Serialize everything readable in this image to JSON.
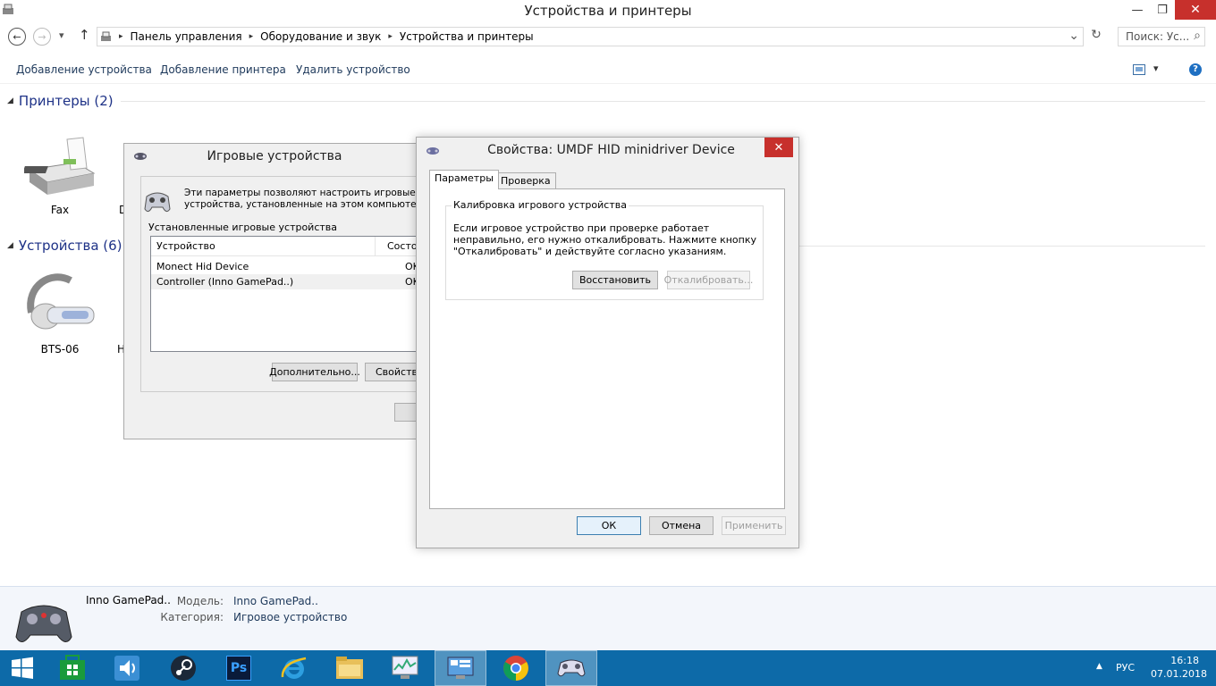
{
  "window": {
    "title": "Устройства и принтеры",
    "minimize": "—",
    "restore": "❐",
    "close": "✕"
  },
  "address": {
    "back": "←",
    "forward": "→",
    "history": "▾",
    "up": "↑",
    "breadcrumbs": [
      "Панель управления",
      "Оборудование и звук",
      "Устройства и принтеры"
    ],
    "sep": "▸",
    "dropdown": "⌄",
    "refresh": "↻",
    "search_placeholder": "Поиск: Ус...",
    "search_icon": "⌕"
  },
  "commands": {
    "add_device": "Добавление устройства",
    "add_printer": "Добавление принтера",
    "remove_device": "Удалить устройство",
    "view_menu": "▾",
    "help": "?"
  },
  "sections": {
    "arrow": "◢",
    "printers": "Принтеры (2)",
    "devices": "Устройства (6)"
  },
  "printers": [
    {
      "label": "Fax"
    },
    {
      "label": "D"
    }
  ],
  "devices": [
    {
      "label": "BTS-06"
    },
    {
      "label": "H"
    }
  ],
  "game_dialog": {
    "title": "Игровые устройства",
    "description": "Эти параметры позволяют настроить игровые устройства, установленные на этом компьютере.",
    "group_label": "Установленные игровые устройства",
    "columns": [
      "Устройство",
      "Состояние"
    ],
    "rows": [
      {
        "device": "Monect Hid Device",
        "status": "OK"
      },
      {
        "device": "Controller (Inno GamePad..)",
        "status": "OK"
      }
    ],
    "advanced_button": "Дополнительно...",
    "properties_button": "Свойства"
  },
  "props_dialog": {
    "title": "Свойства: UMDF HID minidriver Device",
    "close": "✕",
    "tabs": [
      "Параметры",
      "Проверка"
    ],
    "group_label": "Калибровка игрового устройства",
    "group_text": "Если игровое устройство при проверке работает неправильно, его нужно откалибровать. Нажмите кнопку \"Откалибровать\" и действуйте согласно указаниям.",
    "restore_button": "Восстановить",
    "calibrate_button": "Откалибровать...",
    "ok_button": "ОК",
    "cancel_button": "Отмена",
    "apply_button": "Применить"
  },
  "details": {
    "name": "Inno GamePad..",
    "model_label": "Модель:",
    "model_value": "Inno GamePad..",
    "category_label": "Категория:",
    "category_value": "Игровое устройство"
  },
  "taskbar": {
    "items": [
      "windows-start",
      "store",
      "volume-app",
      "steam",
      "photoshop",
      "internet-explorer",
      "file-explorer",
      "performance-monitor",
      "control-panel",
      "chrome",
      "game-controllers"
    ],
    "ps_label": "Ps",
    "tray_up": "▲",
    "lang": "РУС",
    "time": "16:18",
    "date": "07.01.2018"
  },
  "colors": {
    "taskbar": "#0d6aa8",
    "close_red": "#c7302c",
    "link_blue": "#1e395b",
    "section_blue": "#1e3287"
  }
}
